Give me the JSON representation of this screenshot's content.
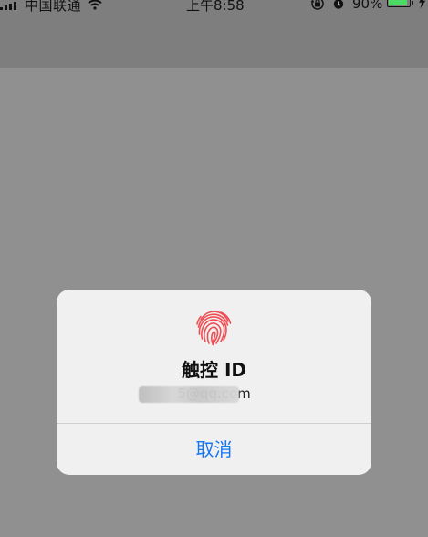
{
  "status_bar": {
    "carrier": "中国联通",
    "time": "上午8:58",
    "battery_percent": "90%",
    "battery_fill_fraction": 0.9,
    "icons": [
      "signal-icon",
      "wifi-icon",
      "orientation-lock-icon",
      "alarm-icon",
      "battery-icon",
      "charging-bolt-icon"
    ]
  },
  "dialog": {
    "title": "触控 ID",
    "account": "5@qq.com",
    "cancel_label": "取消",
    "icon": "fingerprint-icon"
  },
  "colors": {
    "overlay": "#909090",
    "dialog_background": "#f0f0f0",
    "action": "#1677f3",
    "fingerprint": "#ef4f54",
    "battery": "#4cd964"
  }
}
